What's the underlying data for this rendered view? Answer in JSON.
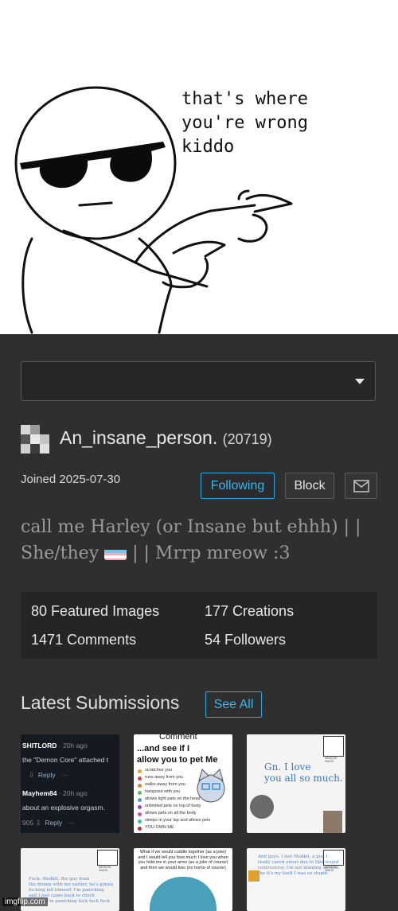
{
  "meme": {
    "text": "that's where\nyou're wrong\nkiddo"
  },
  "profile": {
    "dropdown": {
      "value": ""
    },
    "username": "An_insane_person.",
    "points": "(20719)",
    "joined": "Joined 2025-07-30",
    "buttons": {
      "following": "Following",
      "block": "Block",
      "message_icon": "mail-icon"
    },
    "bio": {
      "part1": "call me Harley (or Insane but ehhh) | | She/they ",
      "part2": " | | Mrrp mreow :3"
    },
    "stats": {
      "featured": "80 Featured Images",
      "creations": "177 Creations",
      "comments": "1471 Comments",
      "followers": "54 Followers"
    },
    "latest": {
      "title": "Latest Submissions",
      "see_all": "See All"
    },
    "thumbs": {
      "t1": {
        "user1": "SHITLORD",
        "meta1": "· 20h ago",
        "line1": "the \"Demon Core\" attached t",
        "reply1": "Reply",
        "more1": "···",
        "user2": "Mayhem84",
        "meta2": "· 20h ago",
        "line2": "about an explosive orgasm.",
        "count2": "905",
        "reply2": "Reply",
        "more2": "···"
      },
      "t2": {
        "comment": "Comment",
        "line1": "...and see if  I",
        "line2": "allow  you to pet Me",
        "items": [
          "scratches you",
          "runs away from you",
          "walks away from you",
          "hangsout with you",
          "allows light pats on the head",
          "unlimited pets on top of body",
          "allows pets on all the body",
          "sleeps in your lap and allows pets",
          "YOU OWN ME"
        ]
      },
      "t3": {
        "text": "Gn. I love\nyou all so much."
      },
      "t4": {
        "text": "Fuck. Medkit, the guy from\nthe drama with me earlier, he's gonna\nfucking kill himself. I'm panicking\nand I just came back to check\non him. I'm panicking fuck fuck fuck"
      },
      "t5": {
        "text": "What if we would cuddle together (as a joke) and I would tell you how much I love you when you hold me in your arms (as a joke of course) and then we would kiss (no homo of course)"
      },
      "t6": {
        "text": "And guys. I lost Medkit, a guy I\nreally cared about due to this stupid\ncontroversy. I'm not blaming anyone\nthe it's my fault I was so stupid."
      },
      "window_image": "WINDOW IMAGE"
    },
    "watermark": "imgflip.com"
  },
  "colors": {
    "accent": "#37b6f0",
    "background": "#2f2f2f",
    "panel": "#252525"
  }
}
